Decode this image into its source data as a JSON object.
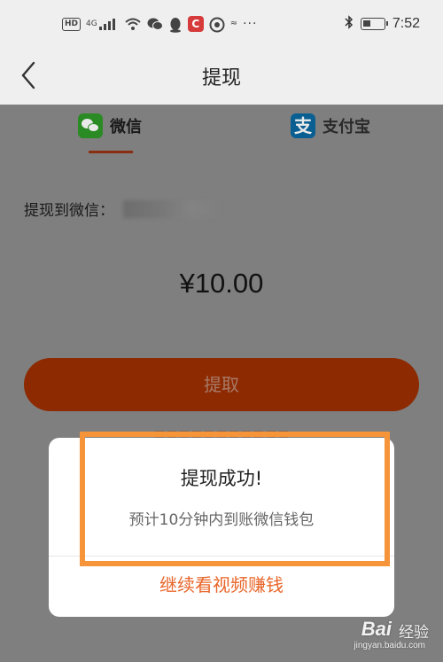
{
  "status_bar": {
    "network_badge": "HD",
    "network_type": "4G",
    "time": "7:52",
    "icons": [
      "hd-icon",
      "signal-icon",
      "wifi-icon",
      "wechat-notify-icon",
      "qq-icon",
      "app-icon",
      "app-icon",
      "app-icon",
      "more-icon",
      "bluetooth-icon",
      "battery-icon"
    ]
  },
  "header": {
    "back_icon": "chevron-left-icon",
    "title": "提现"
  },
  "tabs": [
    {
      "label": "微信",
      "icon": "wechat-icon",
      "selected": true
    },
    {
      "label": "支付宝",
      "icon": "alipay-icon",
      "icon_glyph": "支",
      "selected": false
    }
  ],
  "withdraw_to": {
    "label": "提现到微信："
  },
  "amount": "¥10.00",
  "withdraw_button": "提取",
  "dialog": {
    "title": "提现成功!",
    "message": "预计10分钟内到账微信钱包",
    "action": "继续看视频赚钱"
  },
  "colors": {
    "accent_orange": "#e8662a",
    "highlight": "#f59438",
    "button_dimmed": "#8d2a02"
  },
  "watermark": {
    "brand": "Bai",
    "text": "经验",
    "url": "jingyan.baidu.com"
  }
}
